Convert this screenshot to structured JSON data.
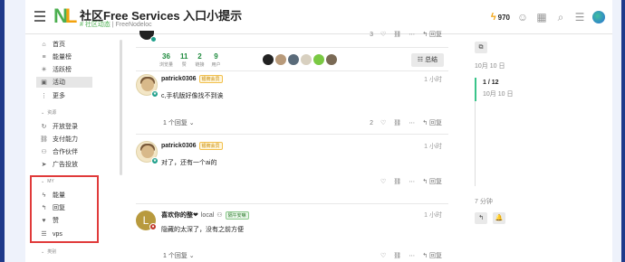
{
  "header": {
    "logo_n": "N",
    "logo_l": "L",
    "title": "社区Free Services 入口小提示",
    "sub_tag": "# 社区动态",
    "sub_sep": " | ",
    "sub_name": "FreeNodeloc",
    "energy": "970"
  },
  "sidebar": {
    "items_top": [
      {
        "icon": "⌂",
        "label": "首页"
      },
      {
        "icon": "≡",
        "label": "能量榜"
      },
      {
        "icon": "✳",
        "label": "活跃榜"
      },
      {
        "icon": "▣",
        "label": "活动"
      },
      {
        "icon": "⋮",
        "label": "更多"
      }
    ],
    "section1": "资源",
    "items_res": [
      {
        "icon": "↻",
        "label": "开放登录"
      },
      {
        "icon": "⛓",
        "label": "支付能力"
      },
      {
        "icon": "⚇",
        "label": "合作伙伴"
      },
      {
        "icon": "➤",
        "label": "广告投放"
      }
    ],
    "section2": "MY",
    "items_my": [
      {
        "icon": "ϟ",
        "label": "能量"
      },
      {
        "icon": "↰",
        "label": "回复"
      },
      {
        "icon": "♥",
        "label": "赞"
      },
      {
        "icon": "☰",
        "label": "vps"
      }
    ],
    "section3": "类别"
  },
  "topic": {
    "top_post": {
      "likes": "3",
      "reply": "回复"
    },
    "stats": [
      {
        "num": "36",
        "label": "浏览量"
      },
      {
        "num": "11",
        "label": "赞"
      },
      {
        "num": "2",
        "label": "链接"
      },
      {
        "num": "9",
        "label": "用户"
      }
    ],
    "summary": "总结",
    "posts": [
      {
        "user": "patrick0306",
        "flair": "银牌会员",
        "time": "1 小时",
        "text": "c,手机版好像找不到诶",
        "replies": "1 个回复",
        "likes": "2",
        "reply": "回复"
      },
      {
        "user": "patrick0306",
        "flair": "银牌会员",
        "time": "1 小时",
        "text": "对了，还有一个ai的",
        "likes": "",
        "reply": "回复"
      },
      {
        "user": "喜欢你的整❤",
        "handle": "local",
        "flair": "隔午安嘛",
        "time": "1 小时",
        "avatar_letter": "L",
        "text": "隐藏的太深了，没有之前方便",
        "replies": "1 个回复",
        "reply": "回复"
      }
    ]
  },
  "timeline": {
    "start_date": "10月 10 日",
    "position": "1 / 12",
    "position_date": "10月 10 日",
    "end_date": "7 分钟"
  },
  "colors": {
    "accent_green": "#1e8a3d",
    "highlight_red": "#e03a3a",
    "flair_gold": "#f2c04d",
    "timeline_green": "#3ac48a"
  }
}
